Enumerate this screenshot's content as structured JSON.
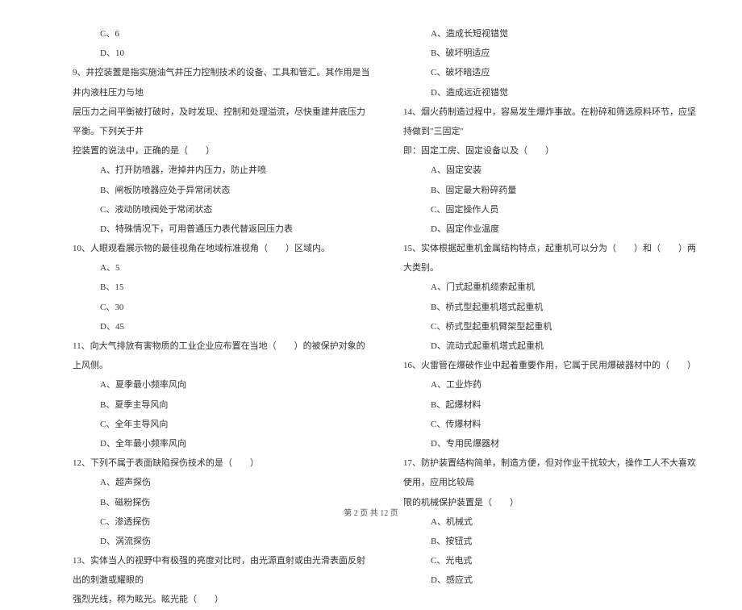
{
  "left": {
    "opt_c6": "C、6",
    "opt_d10": "D、10",
    "q9_line1": "9、井控装置是指实施油气井压力控制技术的设备、工具和管汇。其作用是当井内液柱压力与地",
    "q9_line2": "层压力之间平衡被打破时，及时发现、控制和处理溢流，尽快重建井底压力平衡。下列关于井",
    "q9_line3": "控装置的说法中，正确的是（　　）",
    "q9_a": "A、打开防喷器，泄掉井内压力，防止井喷",
    "q9_b": "B、闸板防喷器应处于异常闭状态",
    "q9_c": "C、液动防喷阀处于常闭状态",
    "q9_d": "D、特殊情况下，可用普通压力表代替返回压力表",
    "q10": "10、人眼观看展示物的最佳视角在地域标准视角（　　）区域内。",
    "q10_a": "A、5",
    "q10_b": "B、15",
    "q10_c": "C、30",
    "q10_d": "D、45",
    "q11": "11、向大气排放有害物质的工业企业应布置在当地（　　）的被保护对象的上风侧。",
    "q11_a": "A、夏季最小频率风向",
    "q11_b": "B、夏季主导风向",
    "q11_c": "C、全年主导风向",
    "q11_d": "D、全年最小频率风向",
    "q12": "12、下列不属于表面缺陷探伤技术的是（　　）",
    "q12_a": "A、超声探伤",
    "q12_b": "B、磁粉探伤",
    "q12_c": "C、渗透探伤",
    "q12_d": "D、涡流探伤",
    "q13_line1": "13、实体当人的视野中有极强的亮度对比时，由光源直射或由光滑表面反射出的刺激或耀眼的",
    "q13_line2": "强烈光线，称为眩光。眩光能（　　）"
  },
  "right": {
    "q13_a": "A、造成长短视错觉",
    "q13_b": "B、破坏明适应",
    "q13_c": "C、破坏暗适应",
    "q13_d": "D、造成远近视错觉",
    "q14_line1": "14、烟火药制造过程中，容易发生爆炸事故。在粉碎和筛选原料环节，应坚持做到\"三固定\"",
    "q14_line2": "即：固定工房、固定设备以及（　　）",
    "q14_a": "A、固定安装",
    "q14_b": "B、固定最大粉碎药量",
    "q14_c": "C、固定操作人员",
    "q14_d": "D、固定作业温度",
    "q15": "15、实体根据起重机金属结构特点，起重机可以分为（　　）和（　　）两大类别。",
    "q15_a": "A、门式起重机缆索起重机",
    "q15_b": "B、桥式型起重机塔式起重机",
    "q15_c": "C、桥式型起重机臂架型起重机",
    "q15_d": "D、流动式起重机塔式起重机",
    "q16": "16、火雷管在爆破作业中起着重要作用，它属于民用爆破器材中的（　　）",
    "q16_a": "A、工业炸药",
    "q16_b": "B、起爆材料",
    "q16_c": "C、传爆材料",
    "q16_d": "D、专用民爆器材",
    "q17_line1": "17、防护装置结构简单，制造方便，但对作业干扰较大，操作工人不大喜欢使用，应用比较局",
    "q17_line2": "限的机械保护装置是（　　）",
    "q17_a": "A、机械式",
    "q17_b": "B、按钮式",
    "q17_c": "C、光电式",
    "q17_d": "D、感应式"
  },
  "footer": "第 2 页 共 12 页"
}
